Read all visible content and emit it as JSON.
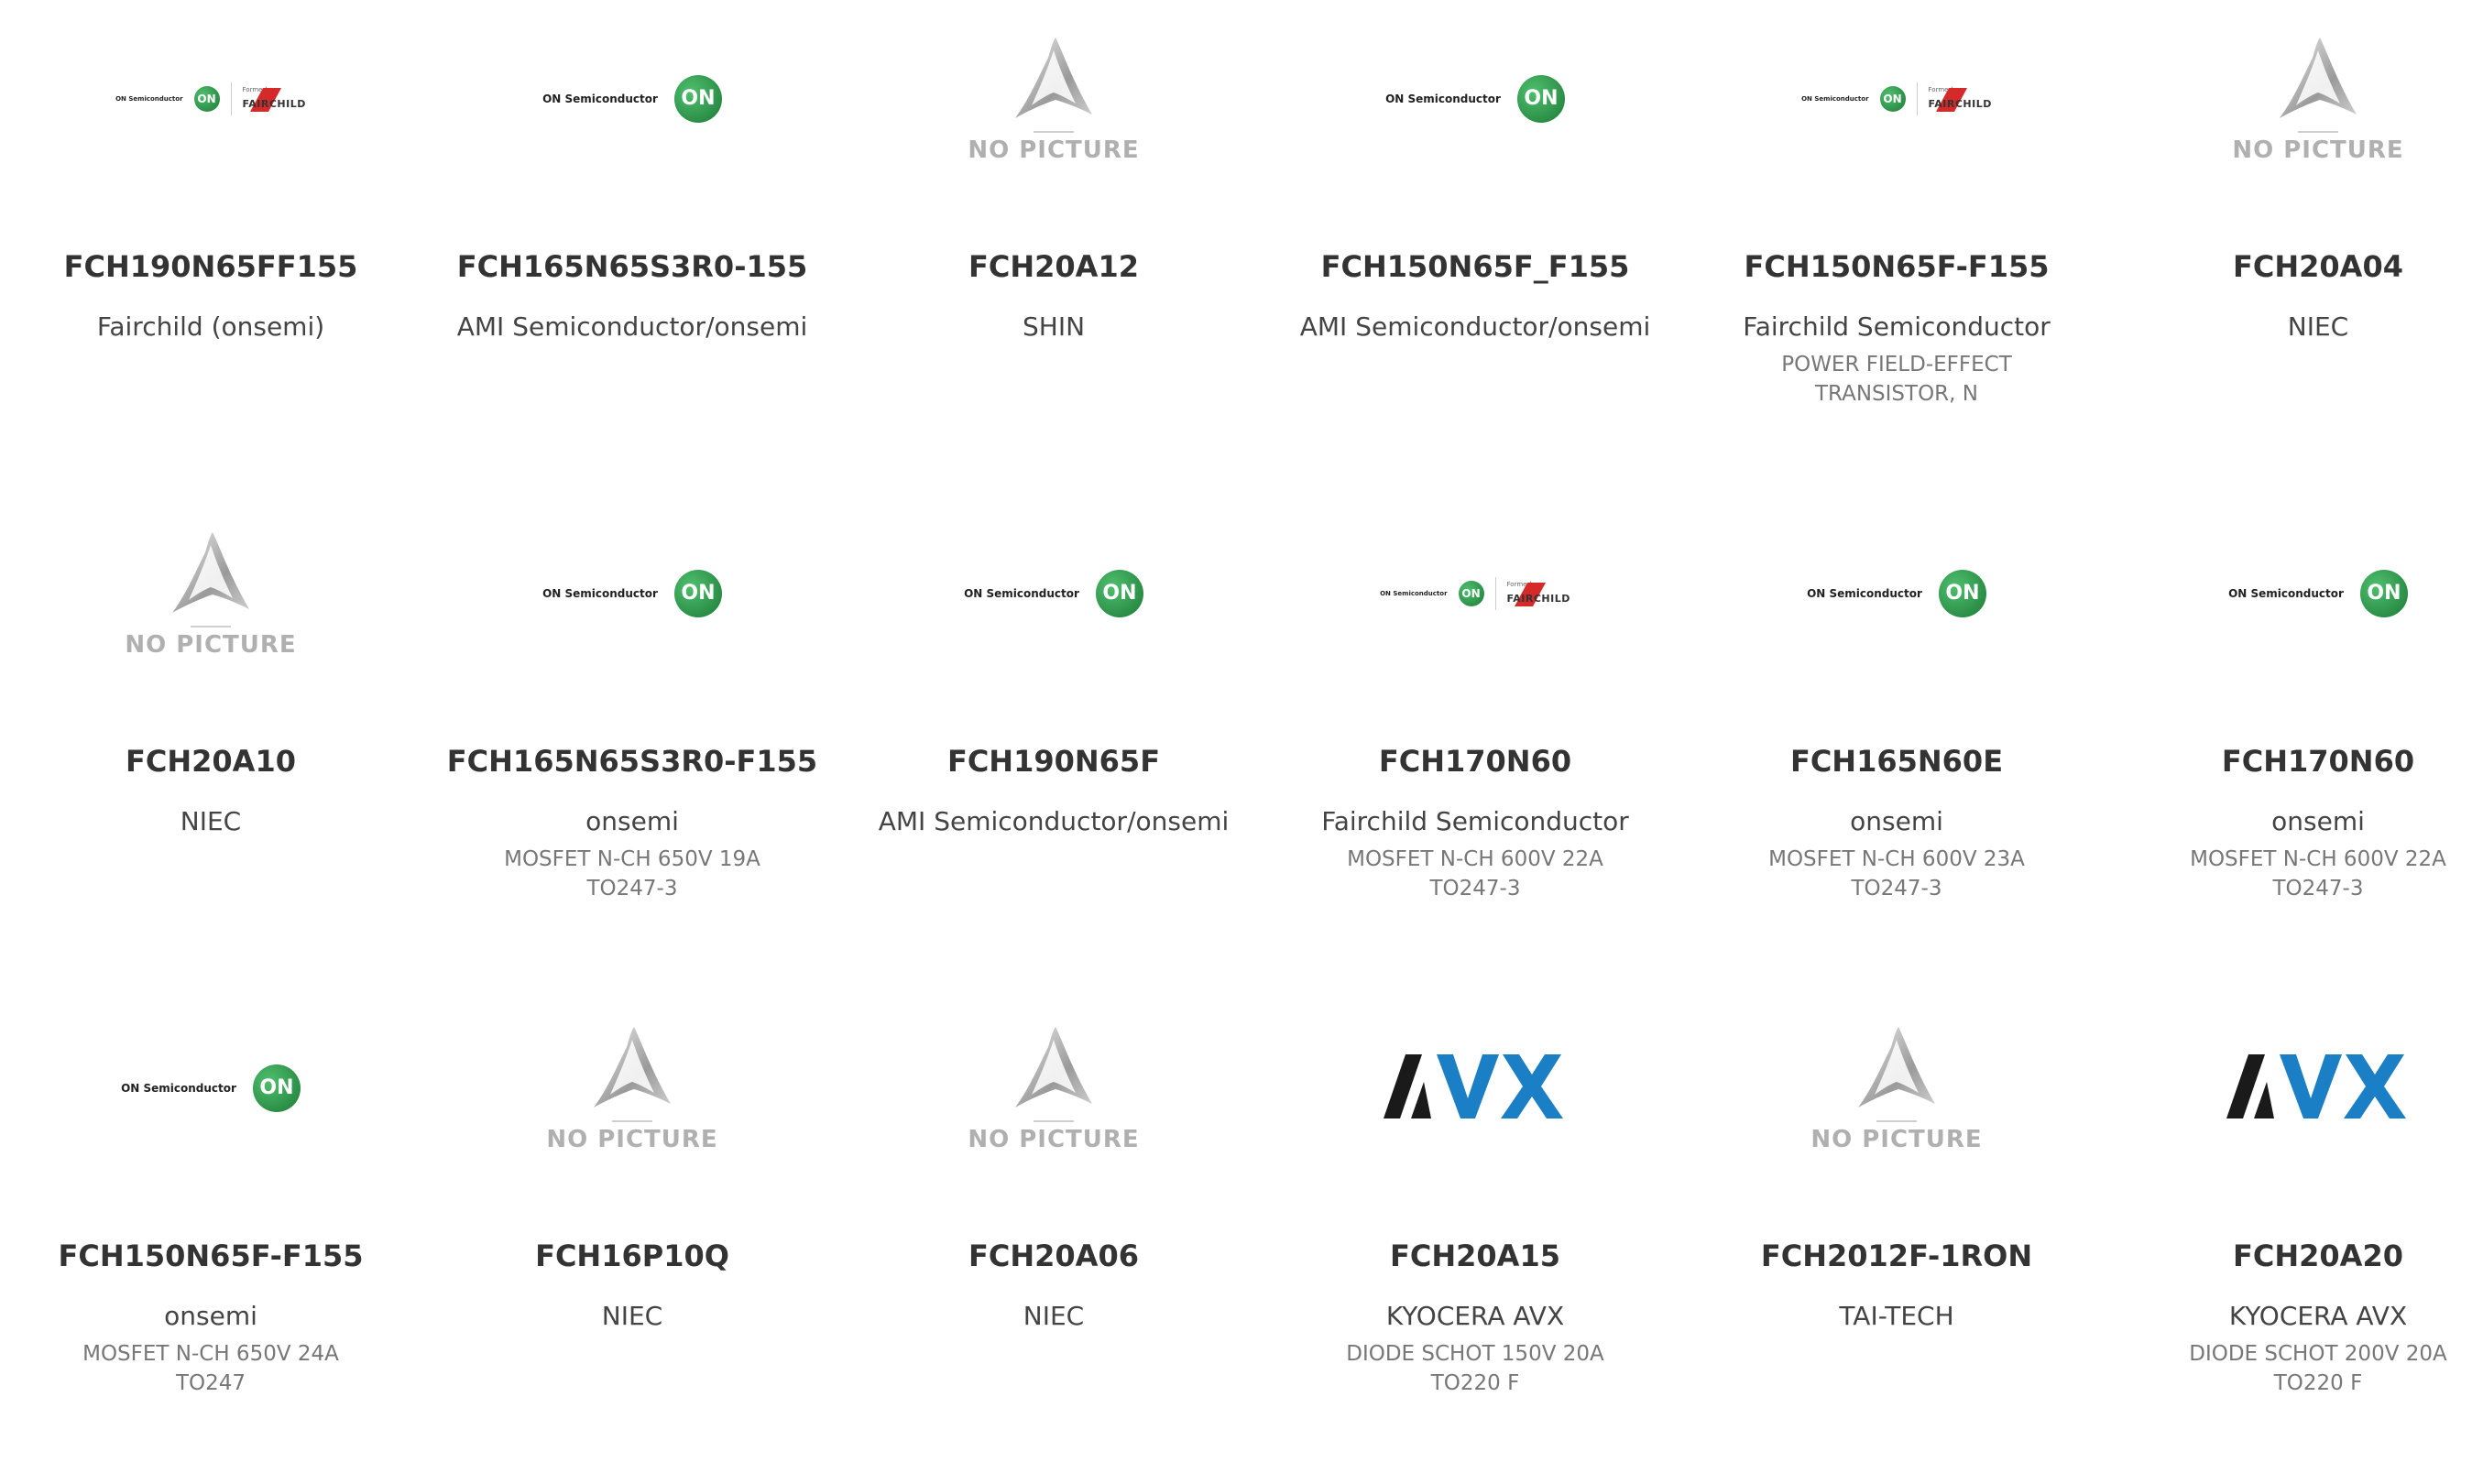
{
  "logo_text": {
    "no_picture": "NO PICTURE",
    "on_semi": "ON Semiconductor",
    "on_badge": "ON",
    "formerly": "Formerly",
    "fairchild": "FAIRCHILD",
    "avx": "AVX"
  },
  "products": [
    {
      "logo": "onsemi-fairchild",
      "part": "FCH190N65FF155",
      "manufacturer": "Fairchild (onsemi)",
      "description": ""
    },
    {
      "logo": "onsemi",
      "part": "FCH165N65S3R0-155",
      "manufacturer": "AMI Semiconductor/onsemi",
      "description": ""
    },
    {
      "logo": "no-picture",
      "part": "FCH20A12",
      "manufacturer": "SHIN",
      "description": ""
    },
    {
      "logo": "onsemi",
      "part": "FCH150N65F_F155",
      "manufacturer": "AMI Semiconductor/onsemi",
      "description": ""
    },
    {
      "logo": "onsemi-fairchild",
      "part": "FCH150N65F-F155",
      "manufacturer": "Fairchild Semiconductor",
      "description": "POWER FIELD-EFFECT TRANSISTOR, N"
    },
    {
      "logo": "no-picture",
      "part": "FCH20A04",
      "manufacturer": "NIEC",
      "description": ""
    },
    {
      "logo": "no-picture",
      "part": "FCH20A10",
      "manufacturer": "NIEC",
      "description": ""
    },
    {
      "logo": "onsemi",
      "part": "FCH165N65S3R0-F155",
      "manufacturer": "onsemi",
      "description": "MOSFET N-CH 650V 19A TO247-3"
    },
    {
      "logo": "onsemi",
      "part": "FCH190N65F",
      "manufacturer": "AMI Semiconductor/onsemi",
      "description": ""
    },
    {
      "logo": "onsemi-fairchild",
      "part": "FCH170N60",
      "manufacturer": "Fairchild Semiconductor",
      "description": "MOSFET N-CH 600V 22A TO247-3"
    },
    {
      "logo": "onsemi",
      "part": "FCH165N60E",
      "manufacturer": "onsemi",
      "description": "MOSFET N-CH 600V 23A TO247-3"
    },
    {
      "logo": "onsemi",
      "part": "FCH170N60",
      "manufacturer": "onsemi",
      "description": "MOSFET N-CH 600V 22A TO247-3"
    },
    {
      "logo": "onsemi",
      "part": "FCH150N65F-F155",
      "manufacturer": "onsemi",
      "description": "MOSFET N-CH 650V 24A TO247"
    },
    {
      "logo": "no-picture",
      "part": "FCH16P10Q",
      "manufacturer": "NIEC",
      "description": ""
    },
    {
      "logo": "no-picture",
      "part": "FCH20A06",
      "manufacturer": "NIEC",
      "description": ""
    },
    {
      "logo": "avx",
      "part": "FCH20A15",
      "manufacturer": "KYOCERA AVX",
      "description": "DIODE SCHOT 150V 20A TO220 F"
    },
    {
      "logo": "no-picture",
      "part": "FCH2012F-1RON",
      "manufacturer": "TAI-TECH",
      "description": ""
    },
    {
      "logo": "avx",
      "part": "FCH20A20",
      "manufacturer": "KYOCERA AVX",
      "description": "DIODE SCHOT 200V 20A TO220 F"
    }
  ],
  "colors": {
    "on_green": "#1c7a36",
    "avx_dark": "#1a1a1a",
    "avx_blue": "#1a7fc4",
    "fairchild_red": "#d62a2a",
    "no_picture_gray": "#b0b0b0"
  }
}
